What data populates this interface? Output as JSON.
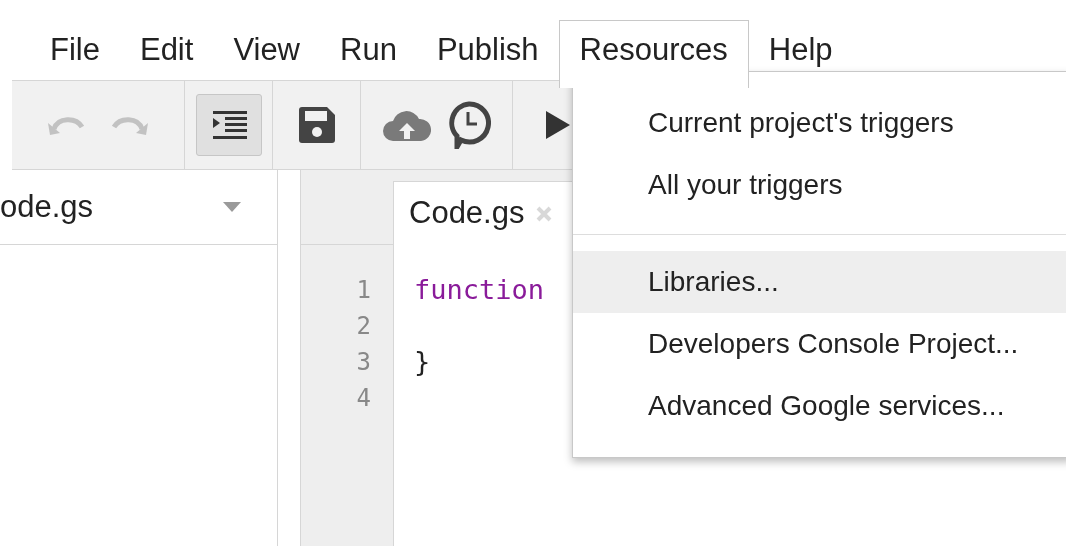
{
  "menubar": [
    {
      "label": "File",
      "selected": false
    },
    {
      "label": "Edit",
      "selected": false
    },
    {
      "label": "View",
      "selected": false
    },
    {
      "label": "Run",
      "selected": false
    },
    {
      "label": "Publish",
      "selected": false
    },
    {
      "label": "Resources",
      "selected": true
    },
    {
      "label": "Help",
      "selected": false
    }
  ],
  "toolbar": {
    "undo_disabled": true,
    "redo_disabled": true,
    "indent_pressed": true
  },
  "file_list": {
    "current": "ode.gs"
  },
  "editor_tab": {
    "label": "Code.gs"
  },
  "code_lines": [
    {
      "number": "1",
      "text": "function",
      "kind": "keyword"
    },
    {
      "number": "2"
    },
    {
      "number": "3",
      "text": "}",
      "kind": "plain"
    },
    {
      "number": "4"
    }
  ],
  "dropdown": {
    "sections": [
      [
        {
          "label": "Current project's triggers",
          "selected": false
        },
        {
          "label": "All your triggers",
          "selected": false
        }
      ],
      [
        {
          "label": "Libraries...",
          "selected": true
        },
        {
          "label": "Developers Console Project...",
          "selected": false
        },
        {
          "label": "Advanced Google services...",
          "selected": false
        }
      ]
    ]
  }
}
